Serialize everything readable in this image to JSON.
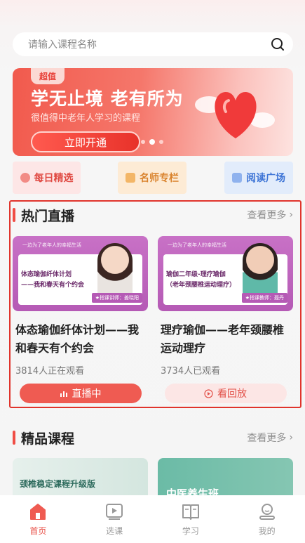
{
  "search": {
    "placeholder": "请输入课程名称"
  },
  "banner": {
    "badge": "超值",
    "title": "学无止境 老有所为",
    "subtitle": "很值得中老年人学习的课程",
    "button": "立即开通",
    "dots": 3,
    "active_dot": 1
  },
  "quick_links": [
    {
      "label": "每日精选",
      "icon": "star-icon",
      "color": "#e04a43"
    },
    {
      "label": "名师专栏",
      "icon": "bookmark-icon",
      "color": "#d9822b"
    },
    {
      "label": "阅读广场",
      "icon": "book-icon",
      "color": "#3d74d6"
    }
  ],
  "hot_live": {
    "title": "热门直播",
    "more": "查看更多",
    "cards": [
      {
        "thumb_lines": [
          "体态瑜伽纤体计划",
          "——我和春天有个约会"
        ],
        "thumb_top": "一边为了老年人的幸福生活",
        "thumb_teacher": "★指课讲师：姜晓阳",
        "name": "体态瑜伽纤体计划——我和春天有个约会",
        "viewers": "3814人正在观看",
        "action": "直播中"
      },
      {
        "thumb_lines": [
          "瑜伽二年级-理疗瑜伽",
          "（老年颈腰椎运动理疗）"
        ],
        "thumb_top": "一边为了老年人的幸福生活",
        "thumb_teacher": "★指课教师：聂丹",
        "name": "理疗瑜伽——老年颈腰椎运动理疗",
        "viewers": "3734人已观看",
        "action": "看回放"
      }
    ]
  },
  "premium": {
    "title": "精品课程",
    "more": "查看更多",
    "cards": [
      {
        "title": "颈椎稳定课程升级版"
      },
      {
        "title": "中医养生班"
      }
    ]
  },
  "tabbar": [
    {
      "label": "首页",
      "icon": "home-icon",
      "active": true
    },
    {
      "label": "选课",
      "icon": "video-icon",
      "active": false
    },
    {
      "label": "学习",
      "icon": "book-open-icon",
      "active": false
    },
    {
      "label": "我的",
      "icon": "user-icon",
      "active": false
    }
  ],
  "colors": {
    "accent": "#e84e45",
    "highlight_border": "#e0342c"
  }
}
